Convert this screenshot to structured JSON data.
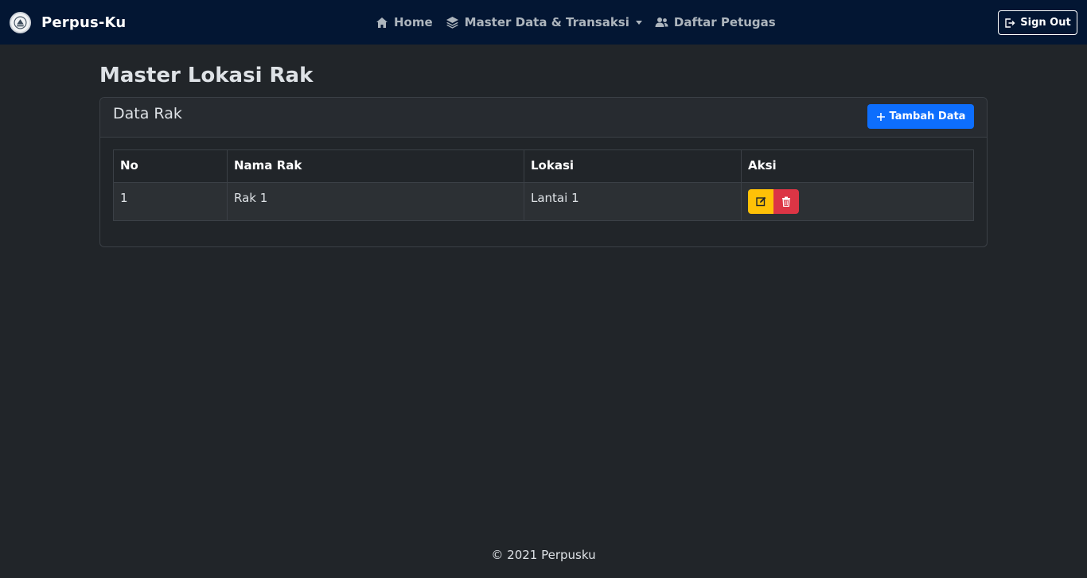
{
  "navbar": {
    "brand": "Perpus-Ku",
    "logo_icon": "library-logo-icon",
    "items": [
      {
        "label": "Home",
        "icon": "home-icon"
      },
      {
        "label": "Master Data & Transaksi",
        "icon": "layers-icon",
        "dropdown": true
      },
      {
        "label": "Daftar Petugas",
        "icon": "users-icon"
      }
    ],
    "signout_label": "Sign Out"
  },
  "main": {
    "page_title": "Master Lokasi Rak",
    "card_title": "Data Rak",
    "add_button_label": "Tambah Data",
    "table": {
      "headers": [
        "No",
        "Nama Rak",
        "Lokasi",
        "Aksi"
      ],
      "rows": [
        {
          "no": "1",
          "nama_rak": "Rak 1",
          "lokasi": "Lantai 1"
        }
      ]
    }
  },
  "footer": {
    "text": "© 2021 Perpusku"
  },
  "colors": {
    "navbar_bg": "#031633",
    "page_bg": "#212529",
    "primary": "#0d6efd",
    "warning": "#ffc107",
    "danger": "#dc3545"
  }
}
